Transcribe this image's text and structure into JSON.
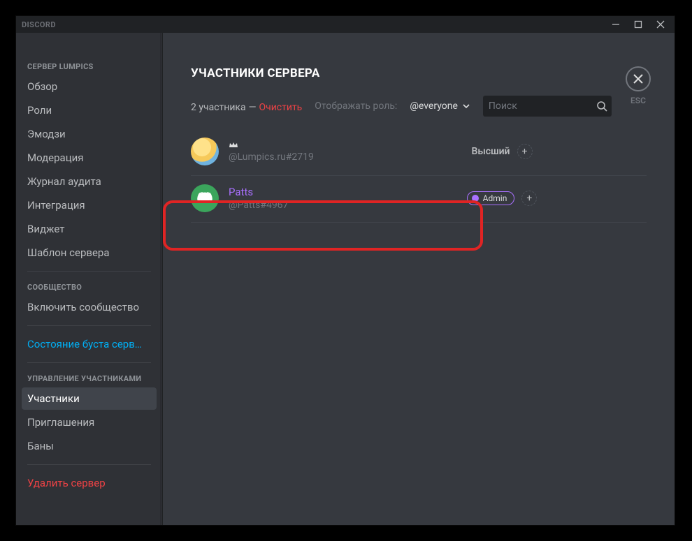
{
  "window": {
    "title": "DISCORD",
    "esc_label": "ESC"
  },
  "sidebar": {
    "sections": [
      {
        "header": "СЕРВЕР LUMPICS"
      },
      {
        "header": "СООБЩЕСТВО"
      },
      {
        "header": "УПРАВЛЕНИЕ УЧАСТНИКАМИ"
      }
    ],
    "items": {
      "overview": "Обзор",
      "roles": "Роли",
      "emoji": "Эмодзи",
      "moderation": "Модерация",
      "audit_log": "Журнал аудита",
      "integrations": "Интеграция",
      "widget": "Виджет",
      "template": "Шаблон сервера",
      "enable_community": "Включить сообщество",
      "boost_status": "Состояние буста серв…",
      "members": "Участники",
      "invites": "Приглашения",
      "bans": "Баны",
      "delete_server": "Удалить сервер"
    }
  },
  "page": {
    "title": "УЧАСТНИКИ СЕРВЕРА",
    "member_count": "2 участника",
    "dash": "—",
    "clear_label": "Очистить",
    "role_filter_label": "Отображать роль:",
    "role_selected": "@everyone",
    "search_placeholder": "Поиск"
  },
  "members": [
    {
      "display_name": "",
      "tag": "@Lumpics.ru#2719",
      "is_owner": true,
      "highest_label": "Высший",
      "roles": []
    },
    {
      "display_name": "Patts",
      "tag": "@Patts#4967",
      "is_owner": false,
      "roles": [
        {
          "name": "Admin",
          "color": "#a970ff"
        }
      ]
    }
  ]
}
